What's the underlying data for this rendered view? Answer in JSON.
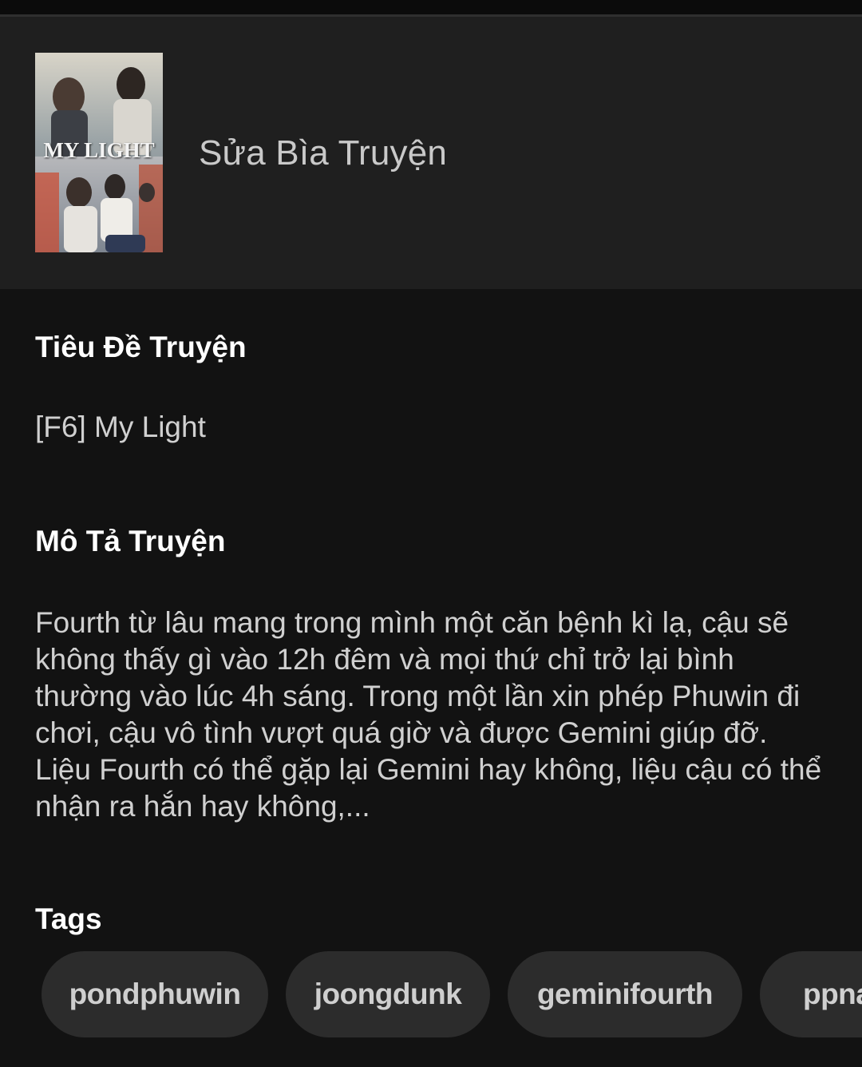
{
  "cover": {
    "thumbnail_title": "MY LIGHT",
    "edit_label": "Sửa Bìa Truyện"
  },
  "title_section": {
    "label": "Tiêu Đề Truyện",
    "value": "[F6] My Light"
  },
  "description_section": {
    "label": "Mô Tả Truyện",
    "value": "Fourth từ lâu mang trong mình một căn bệnh kì lạ, cậu sẽ không thấy gì vào 12h đêm và mọi thứ chỉ trở lại bình thường vào lúc 4h sáng. Trong một lần xin phép Phuwin đi chơi, cậu vô tình vượt quá giờ và được Gemini giúp đỡ. Liệu Fourth có thể gặp lại Gemini hay không, liệu cậu có thể nhận ra hắn hay không,..."
  },
  "tags_section": {
    "label": "Tags",
    "items": [
      "pondphuwin",
      "joongdunk",
      "geminifourth",
      "ppnaravit"
    ]
  },
  "colors": {
    "background": "#121212",
    "cover_section_background": "#1f1f1f",
    "tag_chip_background": "#2c2c2c",
    "label_text": "#ffffff",
    "value_text": "#d0d0d0"
  }
}
